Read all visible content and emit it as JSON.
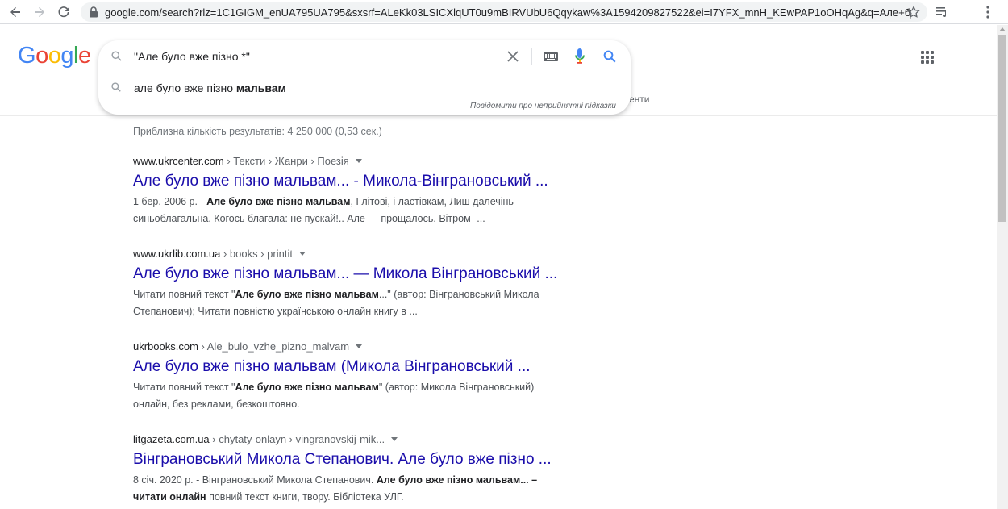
{
  "browser": {
    "url": "google.com/search?rlz=1C1GIGM_enUA795UA795&sxsrf=ALeKk03LSICXlqUT0u9mBIRVUbU6Qqykaw%3A1594209827522&ei=I7YFX_mnH_KEwPAP1oOHqAg&q=Але+бул..."
  },
  "logo": {
    "letters": [
      "G",
      "o",
      "o",
      "g",
      "l",
      "e"
    ],
    "colors": [
      "#4285f4",
      "#ea4335",
      "#fbbc05",
      "#4285f4",
      "#34a853",
      "#ea4335"
    ]
  },
  "search": {
    "query": "\"Але було вже пізно *\"",
    "suggestion_plain": "але було вже пізно ",
    "suggestion_bold": "мальвам",
    "report_text": "Повідомити про неприйнятні підказки"
  },
  "tabs": {
    "partial_label": "енти"
  },
  "stats": "Приблизна кількість результатів: 4 250 000 (0,53 сек.)",
  "results": [
    {
      "domain": "www.ukrcenter.com",
      "crumbs": " › Тексти › Жанри › Поезія",
      "title": "Але було вже пізно мальвам... - Микола-Вінграновський ...",
      "snippet": [
        {
          "t": "1 бер. 2006 р. - ",
          "b": false
        },
        {
          "t": "Але було вже пізно мальвам",
          "b": true
        },
        {
          "t": ", І літові, і ластівкам, Лиш далечінь синьоблагальна. Когось благала: не пускай!.. Але — прощалось. Вітром- ...",
          "b": false
        }
      ]
    },
    {
      "domain": "www.ukrlib.com.ua",
      "crumbs": " › books › printit",
      "title": "Але було вже пізно мальвам... — Микола Вінграновський ...",
      "snippet": [
        {
          "t": "Читати повний текст \"",
          "b": false
        },
        {
          "t": "Але було вже пізно мальвам",
          "b": true
        },
        {
          "t": "...\" (автор: Вінграновський Микола Степанович); Читати повністю українською онлайн книгу в ...",
          "b": false
        }
      ]
    },
    {
      "domain": "ukrbooks.com",
      "crumbs": " › Ale_bulo_vzhe_pizno_malvam",
      "title": "Але було вже пізно мальвам (Микола Вінграновський ...",
      "snippet": [
        {
          "t": "Читати повний текст \"",
          "b": false
        },
        {
          "t": "Але було вже пізно мальвам",
          "b": true
        },
        {
          "t": "\" (автор: Микола Вінграновський) онлайн, без реклами, безкоштовно.",
          "b": false
        }
      ]
    },
    {
      "domain": "litgazeta.com.ua",
      "crumbs": " › chytaty-onlayn › vingranovskij-mik...",
      "title": "Вінграновський Микола Степанович. Але було вже пізно ...",
      "snippet": [
        {
          "t": "8 січ. 2020 р. - Вінграновський Микола Степанович. ",
          "b": false
        },
        {
          "t": "Але було вже пізно мальвам... – читати онлайн",
          "b": true
        },
        {
          "t": " повний текст книги, твору. Бібліотека УЛГ.",
          "b": false
        }
      ]
    }
  ]
}
